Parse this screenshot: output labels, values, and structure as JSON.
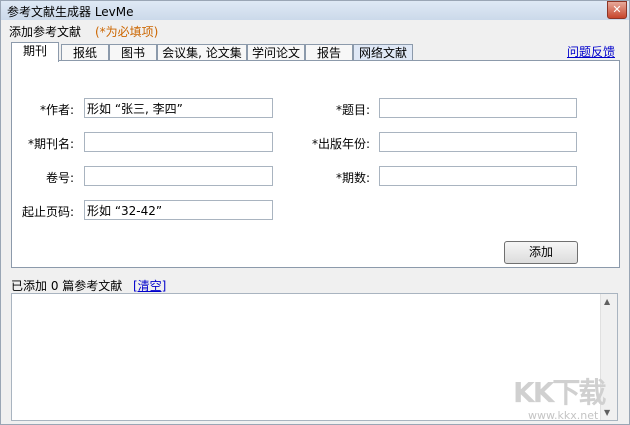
{
  "window": {
    "title": "参考文献生成器  LevMe",
    "close": "✕"
  },
  "header": {
    "subtitle": "添加参考文献",
    "required_note": "(*为必填项)"
  },
  "tabs": [
    "期刊",
    "报纸",
    "图书",
    "会议集, 论文集",
    "学问论文",
    "报告",
    "网络文献"
  ],
  "help_link": "问题反馈",
  "form": {
    "author_label": "*作者:",
    "author_value": "形如 “张三, 李四”",
    "title_label": "*题目:",
    "title_value": "",
    "journal_label": "*期刊名:",
    "journal_value": "",
    "year_label": "*出版年份:",
    "year_value": "",
    "volume_label": "卷号:",
    "volume_value": "",
    "issue_label": "*期数:",
    "issue_value": "",
    "pages_label": "起止页码:",
    "pages_value": "形如 “32-42”",
    "add_button": "添加"
  },
  "status": {
    "count_text": "已添加 0 篇参考文献",
    "clear_link": "[清空]"
  },
  "watermark": {
    "brand": "KK下载",
    "url": "www.kkx.net"
  }
}
